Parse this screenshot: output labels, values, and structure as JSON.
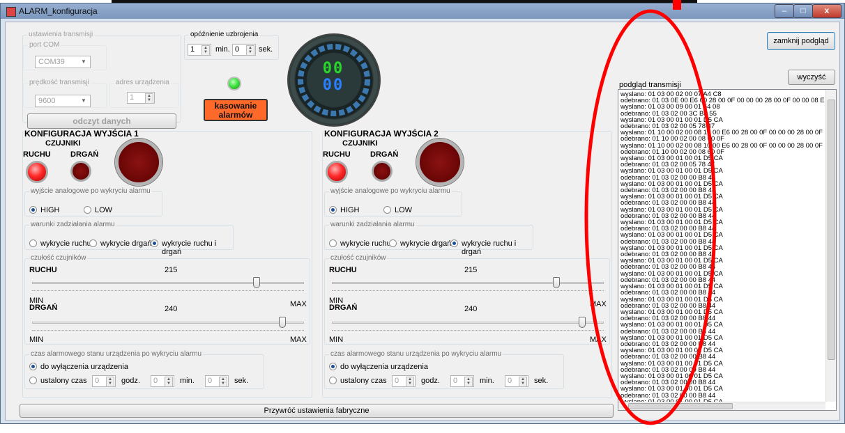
{
  "window": {
    "title": "ALARM_konfiguracja"
  },
  "transmission": {
    "group_label": "ustawienia transmisji",
    "port_label": "port COM",
    "port_value": "COM39",
    "baud_label": "prędkość transmisji",
    "baud_value": "9600",
    "address_label": "adres urządzenia",
    "address_value": "1",
    "read_button": "odczyt danych"
  },
  "arming_delay": {
    "label": "opóźnienie uzbrojenia",
    "minutes": "1",
    "min_label": "min.",
    "seconds": "0",
    "sec_label": "sek."
  },
  "display": {
    "top": "00",
    "bottom": "00"
  },
  "reset_alarms_button": "kasowanie alarmów",
  "close_preview_button": "zamknij podgląd",
  "clear_button": "wyczyść",
  "preview_label": "podgląd transmisji",
  "outputs": [
    {
      "title": "KONFIGURACJA WYJŚCIA 1",
      "sensors_label": "CZUJNIKI",
      "motion_label": "RUCHU",
      "vibration_label": "DRGAŃ",
      "analog_group": "wyjście analogowe po wykryciu alarmu",
      "high": "HIGH",
      "low": "LOW",
      "conditions_group": "warunki zadziałania alarmu",
      "cond_motion": "wykrycie ruchu",
      "cond_vibration": "wykrycie drgań",
      "cond_both": "wykrycie ruchu i drgań",
      "sensitivity_group": "czułość czujników",
      "motion_value": "215",
      "vibration_value": "240",
      "min": "MIN",
      "max": "MAX",
      "state_group": "czas alarmowego stanu urządzenia po wykryciu alarmu",
      "until_off": "do wyłączenia urządzenia",
      "fixed_time": "ustalony czas",
      "hours": "0",
      "hours_label": "godz.",
      "minutes": "0",
      "minutes_label": "min.",
      "seconds": "0",
      "seconds_label": "sek."
    },
    {
      "title": "KONFIGURACJA WYJŚCIA 2",
      "sensors_label": "CZUJNIKI",
      "motion_label": "RUCHU",
      "vibration_label": "DRGAŃ",
      "analog_group": "wyjście analogowe po wykryciu alarmu",
      "high": "HIGH",
      "low": "LOW",
      "conditions_group": "warunki zadziałania alarmu",
      "cond_motion": "wykrycie ruchu",
      "cond_vibration": "wykrycie drgań",
      "cond_both": "wykrycie ruchu i drgań",
      "sensitivity_group": "czułość czujników",
      "motion_value": "215",
      "vibration_value": "240",
      "min": "MIN",
      "max": "MAX",
      "state_group": "czas alarmowego stanu urządzenia po wykryciu alarmu",
      "until_off": "do wyłączenia urządzenia",
      "fixed_time": "ustalony czas",
      "hours": "0",
      "hours_label": "godz.",
      "minutes": "0",
      "minutes_label": "min.",
      "seconds": "0",
      "seconds_label": "sek."
    }
  ],
  "restore_button": "Przywróć ustawienia fabryczne",
  "log_lines": [
    "wyslano:  01 03 00 02 00 07 A4 C8",
    "odebrano: 01 03 0E 00 E6 00 28 00 0F 00 00 00 28 00 0F 00 00 08 E7",
    "wyslano:  01 03 00 09 00 01 54 08",
    "odebrano: 01 03 02 00 3C B8 55",
    "wyslano:  01 03 00 01 00 01 D5 CA",
    "odebrano: 01 03 02 00 05 78 47",
    "wyslano:  01 10 00 02 00 08 10 00 E6 00 28 00 0F 00 00 00 28 00 0F 00",
    "odebrano: 01 10 00 02 00 08 60 0F",
    "wyslano:  01 10 00 02 00 08 10 00 E6 00 28 00 0F 00 00 00 28 00 0F 00",
    "odebrano: 01 10 00 02 00 08 60 0F",
    "wyslano:  01 03 00 01 00 01 D5 CA",
    "odebrano: 01 03 02 00 05 78 47",
    "wyslano:  01 03 00 01 00 01 D5 CA",
    "odebrano: 01 03 02 00 00 B8 44",
    "wyslano:  01 03 00 01 00 01 D5 CA",
    "odebrano: 01 03 02 00 00 B8 44",
    "wyslano:  01 03 00 01 00 01 D5 CA",
    "odebrano: 01 03 02 00 00 B8 44",
    "wyslano:  01 03 00 01 00 01 D5 CA",
    "odebrano: 01 03 02 00 00 B8 44",
    "wyslano:  01 03 00 01 00 01 D5 CA",
    "odebrano: 01 03 02 00 00 B8 44",
    "wyslano:  01 03 00 01 00 01 D5 CA",
    "odebrano: 01 03 02 00 00 B8 44",
    "wyslano:  01 03 00 01 00 01 D5 CA",
    "odebrano: 01 03 02 00 00 B8 44",
    "wyslano:  01 03 00 01 00 01 D5 CA",
    "odebrano: 01 03 02 00 00 B8 44",
    "wyslano:  01 03 00 01 00 01 D5 CA",
    "odebrano: 01 03 02 00 00 B8 44",
    "wyslano:  01 03 00 01 00 01 D5 CA",
    "odebrano: 01 03 02 00 00 B8 44",
    "wyslano:  01 03 00 01 00 01 D5 CA",
    "odebrano: 01 03 02 00 00 B8 44",
    "wyslano:  01 03 00 01 00 01 D5 CA",
    "odebrano: 01 03 02 00 00 B8 44",
    "wyslano:  01 03 00 01 00 01 D5 CA",
    "odebrano: 01 03 02 00 00 B8 44",
    "wyslano:  01 03 00 01 00 01 D5 CA",
    "odebrano: 01 03 02 00 00 B8 44",
    "wyslano:  01 03 00 01 00 01 D5 CA",
    "odebrano: 01 03 02 00 00 B8 44",
    "wyslano:  01 03 00 01 00 01 D5 CA",
    "odebrano: 01 03 02 00 00 B8 44",
    "wyslano:  01 03 00 01 00 01 D5 CA",
    "odebrano: 01 03 02 00 00 B8 44",
    "wyslano:  01 03 00 01 00 01 D5 CA",
    "odebrano: 01 03 02 00 00 B8 44",
    "wyslano:  01 03 00 01 00 01 D5 CA"
  ],
  "colors": {
    "led_red_on": "#ff2a2a",
    "led_red_off": "#7a0000",
    "led_green": "#38e038",
    "reset_button_bg": "#ff6a2a",
    "digits_green": "#28d828",
    "digits_blue": "#2a80ff",
    "annotation_red": "#ff0000"
  }
}
